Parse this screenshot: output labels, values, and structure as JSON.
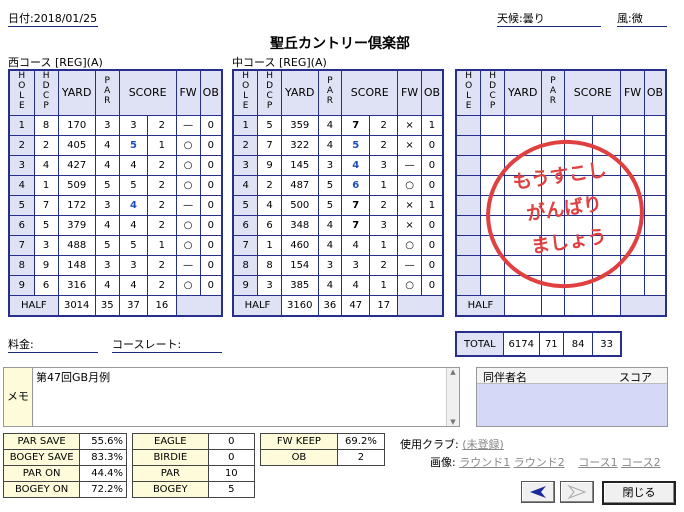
{
  "header": {
    "date_label": "日付:",
    "date": "2018/01/25",
    "weather_label": "天候:",
    "weather": "曇り",
    "wind_label": "風:",
    "wind": "微",
    "course_title": "聖丘カントリー倶楽部"
  },
  "columns": {
    "hole": "HOLE",
    "hdcp": "HDCP",
    "yard": "YARD",
    "par": "PAR",
    "score": "SCORE",
    "fw": "FW",
    "ob": "OB"
  },
  "west": {
    "label": "西コース [REG](A)",
    "rows": [
      {
        "hole": "1",
        "hdcp": "8",
        "yard": "170",
        "par": "3",
        "score": "3",
        "putt": "2",
        "fw": "—",
        "ob": "0"
      },
      {
        "hole": "2",
        "hdcp": "2",
        "yard": "405",
        "par": "4",
        "score": "5",
        "putt": "1",
        "fw": "○",
        "ob": "0"
      },
      {
        "hole": "3",
        "hdcp": "4",
        "yard": "427",
        "par": "4",
        "score": "4",
        "putt": "2",
        "fw": "○",
        "ob": "0"
      },
      {
        "hole": "4",
        "hdcp": "1",
        "yard": "509",
        "par": "5",
        "score": "5",
        "putt": "2",
        "fw": "○",
        "ob": "0"
      },
      {
        "hole": "5",
        "hdcp": "7",
        "yard": "172",
        "par": "3",
        "score": "4",
        "putt": "2",
        "fw": "—",
        "ob": "0"
      },
      {
        "hole": "6",
        "hdcp": "5",
        "yard": "379",
        "par": "4",
        "score": "4",
        "putt": "2",
        "fw": "○",
        "ob": "0"
      },
      {
        "hole": "7",
        "hdcp": "3",
        "yard": "488",
        "par": "5",
        "score": "5",
        "putt": "1",
        "fw": "○",
        "ob": "0"
      },
      {
        "hole": "8",
        "hdcp": "9",
        "yard": "148",
        "par": "3",
        "score": "3",
        "putt": "2",
        "fw": "—",
        "ob": "0"
      },
      {
        "hole": "9",
        "hdcp": "6",
        "yard": "316",
        "par": "4",
        "score": "4",
        "putt": "2",
        "fw": "○",
        "ob": "0"
      }
    ],
    "half": {
      "label": "HALF",
      "yard": "3014",
      "par": "35",
      "score": "37",
      "putt": "16"
    }
  },
  "middle": {
    "label": "中コース [REG](A)",
    "rows": [
      {
        "hole": "1",
        "hdcp": "5",
        "yard": "359",
        "par": "4",
        "score": "7",
        "putt": "2",
        "fw": "×",
        "ob": "1"
      },
      {
        "hole": "2",
        "hdcp": "7",
        "yard": "322",
        "par": "4",
        "score": "5",
        "putt": "2",
        "fw": "×",
        "ob": "0"
      },
      {
        "hole": "3",
        "hdcp": "9",
        "yard": "145",
        "par": "3",
        "score": "4",
        "putt": "3",
        "fw": "—",
        "ob": "0"
      },
      {
        "hole": "4",
        "hdcp": "2",
        "yard": "487",
        "par": "5",
        "score": "6",
        "putt": "1",
        "fw": "○",
        "ob": "0"
      },
      {
        "hole": "5",
        "hdcp": "4",
        "yard": "500",
        "par": "5",
        "score": "7",
        "putt": "2",
        "fw": "×",
        "ob": "1"
      },
      {
        "hole": "6",
        "hdcp": "6",
        "yard": "348",
        "par": "4",
        "score": "7",
        "putt": "3",
        "fw": "×",
        "ob": "0"
      },
      {
        "hole": "7",
        "hdcp": "1",
        "yard": "460",
        "par": "4",
        "score": "4",
        "putt": "1",
        "fw": "○",
        "ob": "0"
      },
      {
        "hole": "8",
        "hdcp": "8",
        "yard": "154",
        "par": "3",
        "score": "3",
        "putt": "2",
        "fw": "—",
        "ob": "0"
      },
      {
        "hole": "9",
        "hdcp": "3",
        "yard": "385",
        "par": "4",
        "score": "4",
        "putt": "1",
        "fw": "○",
        "ob": "0"
      }
    ],
    "half": {
      "label": "HALF",
      "yard": "3160",
      "par": "36",
      "score": "47",
      "putt": "17"
    }
  },
  "third": {
    "half": {
      "label": "HALF"
    }
  },
  "total": {
    "label": "TOTAL",
    "yard": "6174",
    "par": "71",
    "score": "84",
    "putt": "33"
  },
  "stamp": {
    "line1": "もうすこし",
    "line2": "がんばり",
    "line3": "ましょう"
  },
  "fee_label": "料金:",
  "rate_label": "コースレート:",
  "memo": {
    "label": "メモ",
    "text": "第47回GB月例"
  },
  "companion": {
    "name_header": "同伴者名",
    "score_header": "スコア"
  },
  "stats_left": [
    {
      "label": "PAR SAVE",
      "value": "55.6%"
    },
    {
      "label": "BOGEY SAVE",
      "value": "83.3%"
    },
    {
      "label": "PAR ON",
      "value": "44.4%"
    },
    {
      "label": "BOGEY ON",
      "value": "72.2%"
    }
  ],
  "stats_mid": [
    {
      "label": "EAGLE",
      "value": "0"
    },
    {
      "label": "BIRDIE",
      "value": "0"
    },
    {
      "label": "PAR",
      "value": "10"
    },
    {
      "label": "BOGEY",
      "value": "5"
    }
  ],
  "stats_right": [
    {
      "label": "FW KEEP",
      "value": "69.2%"
    },
    {
      "label": "OB",
      "value": "2"
    }
  ],
  "club_label": "使用クラブ:",
  "club_value": "(未登録)",
  "image_label": "画像:",
  "image_links": [
    "ラウンド1",
    "ラウンド2",
    "コース1",
    "コース2"
  ],
  "buttons": {
    "close": "閉じる"
  }
}
